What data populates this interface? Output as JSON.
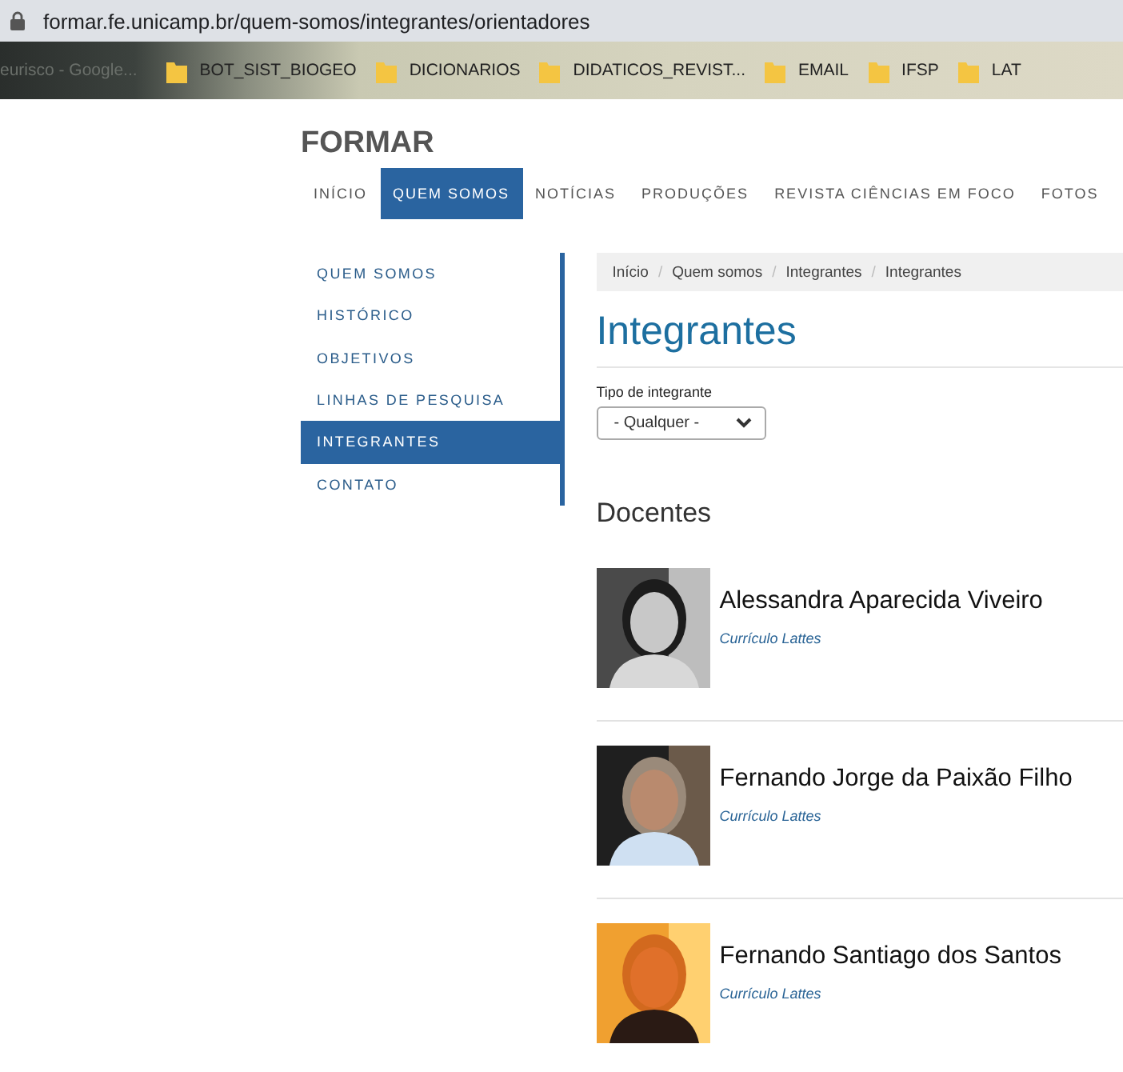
{
  "browser": {
    "url": "formar.fe.unicamp.br/quem-somos/integrantes/orientadores",
    "bookmarks": [
      {
        "label": "eurisco - Google...",
        "folder": false
      },
      {
        "label": "BOT_SIST_BIOGEO",
        "folder": true
      },
      {
        "label": "DICIONARIOS",
        "folder": true
      },
      {
        "label": "DIDATICOS_REVIST...",
        "folder": true
      },
      {
        "label": "EMAIL",
        "folder": true
      },
      {
        "label": "IFSP",
        "folder": true
      },
      {
        "label": "LAT",
        "folder": true
      }
    ]
  },
  "site": {
    "title": "FORMAR",
    "nav": [
      {
        "label": "INÍCIO",
        "selected": false
      },
      {
        "label": "QUEM SOMOS",
        "selected": true
      },
      {
        "label": "NOTÍCIAS",
        "selected": false
      },
      {
        "label": "PRODUÇÕES",
        "selected": false
      },
      {
        "label": "REVISTA CIÊNCIAS EM FOCO",
        "selected": false
      },
      {
        "label": "FOTOS",
        "selected": false
      }
    ]
  },
  "sidebar": {
    "items": [
      {
        "label": "QUEM SOMOS",
        "selected": false
      },
      {
        "label": "HISTÓRICO",
        "selected": false
      },
      {
        "label": "OBJETIVOS",
        "selected": false
      },
      {
        "label": "LINHAS DE PESQUISA",
        "selected": false
      },
      {
        "label": "INTEGRANTES",
        "selected": true
      },
      {
        "label": "CONTATO",
        "selected": false
      }
    ]
  },
  "breadcrumb": {
    "separator": "/",
    "items": [
      "Início",
      "Quem somos",
      "Integrantes",
      "Integrantes"
    ]
  },
  "page_title": "Integrantes",
  "filter": {
    "label": "Tipo de integrante",
    "value": "- Qualquer -"
  },
  "section_title": "Docentes",
  "people": [
    {
      "name": "Alessandra Aparecida Viveiro",
      "link": "Currículo Lattes"
    },
    {
      "name": "Fernando Jorge da Paixão Filho",
      "link": "Currículo Lattes"
    },
    {
      "name": "Fernando Santiago dos Santos",
      "link": "Currículo Lattes"
    }
  ]
}
